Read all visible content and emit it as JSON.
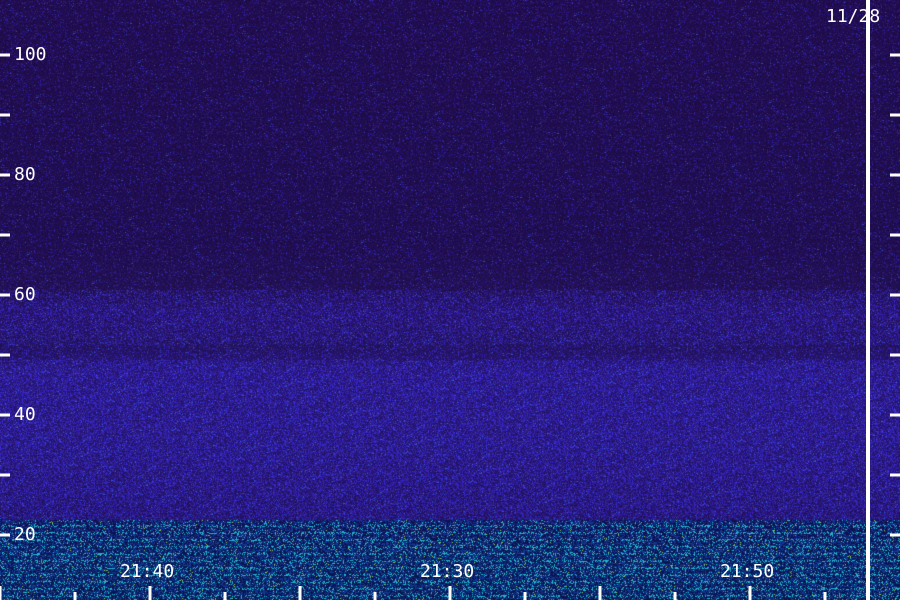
{
  "chart_data": {
    "type": "heatmap",
    "date_label": "11/28",
    "y_ticks_labeled": [
      "100",
      "80",
      "60",
      "40",
      "20"
    ],
    "y_tick_values": [
      100,
      80,
      60,
      40,
      20
    ],
    "y_minor_values": [
      90,
      70,
      50,
      30
    ],
    "ylim": [
      12,
      110
    ],
    "x_tick_labels": [
      "21:40",
      "21:30",
      "21:50"
    ],
    "colors": {
      "low": "#1b0a40",
      "mid": "#2e22a8",
      "high": "#20d0e0",
      "peak": "#c8f040"
    }
  }
}
